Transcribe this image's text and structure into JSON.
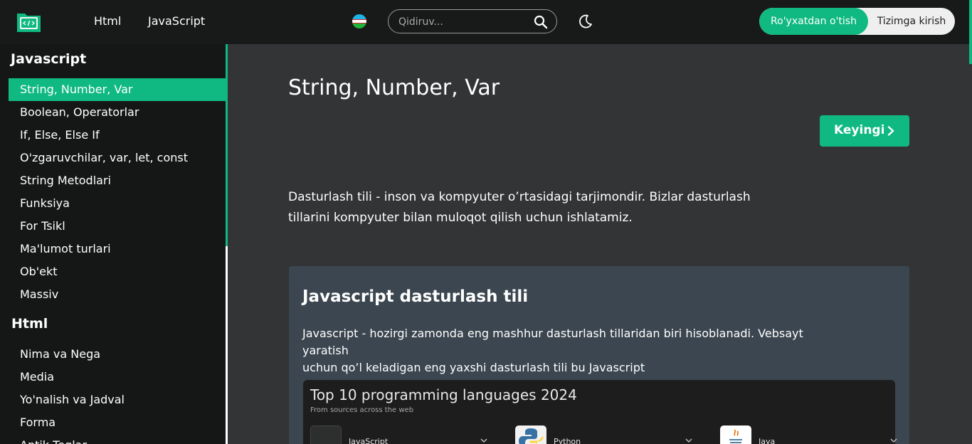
{
  "header": {
    "nav": [
      "Html",
      "JavaScript"
    ],
    "search_placeholder": "Qidiruv...",
    "register_label": "Ro'yxatdan o'tish",
    "login_label": "Tizimga kirish"
  },
  "sidebar": {
    "sections": [
      {
        "title": "Javascript",
        "items": [
          "String, Number, Var",
          "Boolean, Operatorlar",
          "If, Else, Else If",
          "O'zgaruvchilar, var, let, const",
          "String Metodlari",
          "Funksiya",
          "For Tsikl",
          "Ma'lumot turlari",
          "Ob'ekt",
          "Massiv"
        ]
      },
      {
        "title": "Html",
        "items": [
          "Nima va Nega",
          "Media",
          "Yo'nalish va Jadval",
          "Forma",
          "Antik Teglar"
        ]
      }
    ],
    "active_item": "String, Number, Var"
  },
  "main": {
    "title": "String, Number, Var",
    "next_label": "Keyingi",
    "intro_lines": [
      "Dasturlash tili - inson va kompyuter o’rtasidagi tarjimondir. Bizlar dasturlash",
      "tillarini kompyuter bilan muloqot qilish uchun ishlatamiz."
    ],
    "card": {
      "title": "Javascript dasturlash tili",
      "text_lines": [
        "Javascript - hozirgi zamonda eng mashhur dasturlash tillaridan biri hisoblanadi. Vebsayt yaratish",
        "uchun qo’l keladigan eng yaxshi dasturlash tili bu Javascript"
      ],
      "embed": {
        "title": "Top 10 programming languages 2024",
        "subtitle": "From sources across the web",
        "languages": [
          "JavaScript",
          "Python",
          "Java"
        ]
      }
    }
  },
  "colors": {
    "accent": "#10b981",
    "header_bg": "#171a19",
    "sidebar_bg": "#151716",
    "main_bg": "#333436",
    "card_bg": "#3b4650"
  }
}
